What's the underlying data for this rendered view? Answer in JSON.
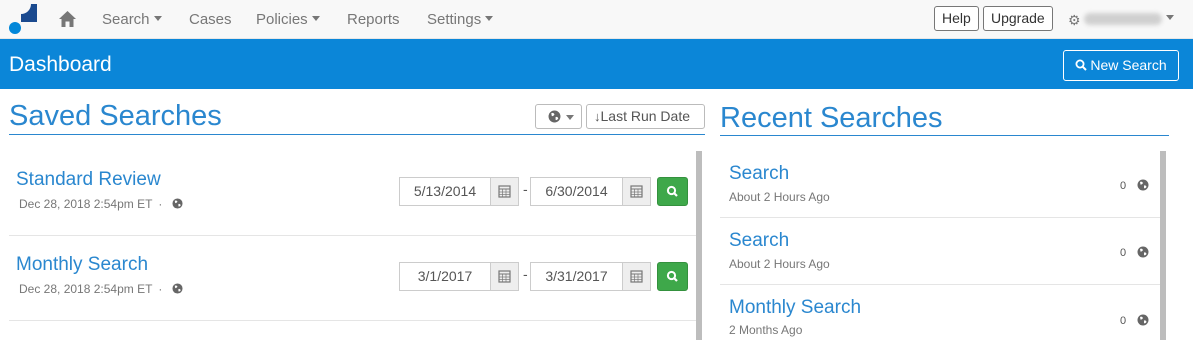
{
  "nav": {
    "items": [
      {
        "label": "Search",
        "dropdown": true
      },
      {
        "label": "Cases",
        "dropdown": false
      },
      {
        "label": "Policies",
        "dropdown": true
      },
      {
        "label": "Reports",
        "dropdown": false
      },
      {
        "label": "Settings",
        "dropdown": true
      }
    ],
    "help_label": "Help",
    "upgrade_label": "Upgrade"
  },
  "header": {
    "title": "Dashboard",
    "new_search_label": "New Search"
  },
  "saved": {
    "title": "Saved Searches",
    "sort_label": "Last Run Date",
    "items": [
      {
        "title": "Standard Review",
        "subtitle": "Dec 28, 2018 2:54pm ET",
        "from": "5/13/2014",
        "to": "6/30/2014"
      },
      {
        "title": "Monthly Search",
        "subtitle": "Dec 28, 2018 2:54pm ET",
        "from": "3/1/2017",
        "to": "3/31/2017"
      }
    ]
  },
  "recent": {
    "title": "Recent Searches",
    "items": [
      {
        "title": "Search",
        "subtitle": "About 2 Hours Ago",
        "count": "0"
      },
      {
        "title": "Search",
        "subtitle": "About 2 Hours Ago",
        "count": "0"
      },
      {
        "title": "Monthly Search",
        "subtitle": "2 Months Ago",
        "count": "0"
      }
    ]
  },
  "colors": {
    "primary": "#0b86d8",
    "link": "#2a87cf",
    "success": "#3ea84a"
  },
  "icons": [
    "home-icon",
    "gear-icon",
    "globe-icon",
    "search-icon",
    "calendar-icon",
    "sort-down-icon"
  ]
}
